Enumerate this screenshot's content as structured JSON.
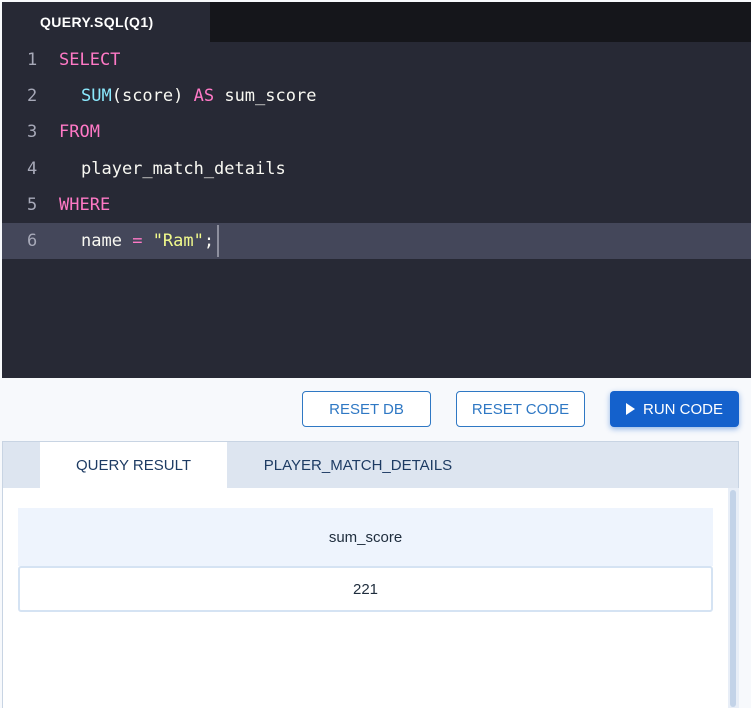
{
  "editor": {
    "file_tab": "QUERY.SQL(Q1)",
    "lines": [
      {
        "num": "1",
        "tokens": [
          {
            "t": "SELECT",
            "k": "kw"
          }
        ]
      },
      {
        "num": "2",
        "tokens": [
          {
            "t": "SUM",
            "k": "fn"
          },
          {
            "t": "(score) ",
            "k": "id"
          },
          {
            "t": "AS",
            "k": "kw"
          },
          {
            "t": " sum_score",
            "k": "id"
          }
        ]
      },
      {
        "num": "3",
        "tokens": [
          {
            "t": "FROM",
            "k": "kw"
          }
        ]
      },
      {
        "num": "4",
        "tokens": [
          {
            "t": "player_match_details",
            "k": "id"
          }
        ]
      },
      {
        "num": "5",
        "tokens": [
          {
            "t": "WHERE",
            "k": "kw"
          }
        ]
      },
      {
        "num": "6",
        "tokens": [
          {
            "t": "name ",
            "k": "id"
          },
          {
            "t": "=",
            "k": "kw"
          },
          {
            "t": " ",
            "k": "id"
          },
          {
            "t": "\"Ram\"",
            "k": "str"
          },
          {
            "t": ";",
            "k": "id"
          }
        ]
      }
    ]
  },
  "toolbar": {
    "reset_db": "RESET DB",
    "reset_code": "RESET CODE",
    "run_code": "RUN CODE"
  },
  "results": {
    "tabs": [
      "QUERY RESULT",
      "PLAYER_MATCH_DETAILS"
    ],
    "active_tab": 0,
    "columns": [
      "sum_score"
    ],
    "rows": [
      [
        "221"
      ]
    ]
  },
  "colors": {
    "editor_bg": "#272935",
    "keyword": "#ff79c6",
    "function": "#8be9fd",
    "string": "#f1fa8c",
    "primary": "#1461cc"
  }
}
